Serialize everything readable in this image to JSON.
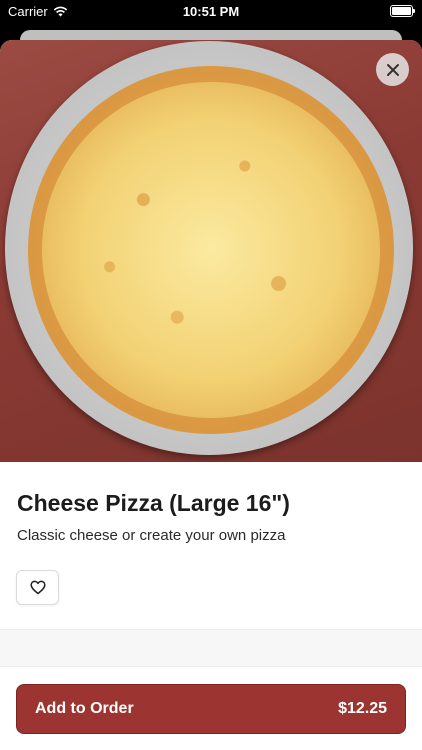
{
  "status_bar": {
    "carrier": "Carrier",
    "time": "10:51 PM"
  },
  "item": {
    "name": "Cheese Pizza (Large 16\")",
    "description": "Classic cheese or create your own pizza"
  },
  "actions": {
    "add_label": "Add to Order",
    "price": "$12.25"
  },
  "colors": {
    "accent": "#9c3531"
  },
  "icons": {
    "close": "close-icon",
    "favorite": "heart-outline-icon",
    "wifi": "wifi-icon",
    "battery": "battery-icon"
  }
}
